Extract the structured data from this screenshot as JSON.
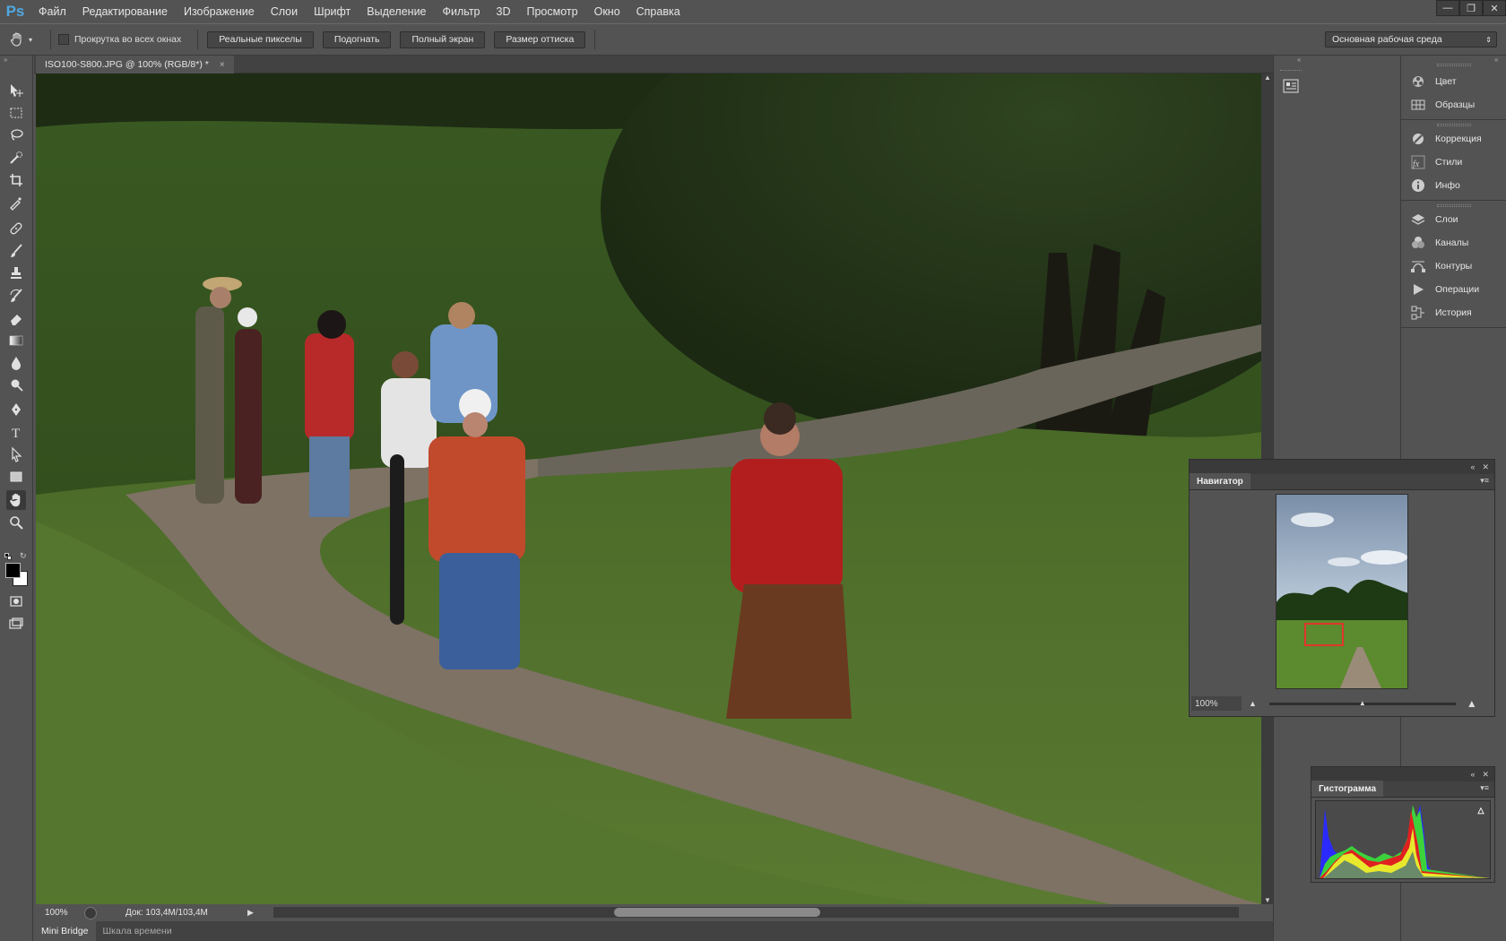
{
  "app": {
    "logo": "Ps"
  },
  "menu": [
    "Файл",
    "Редактирование",
    "Изображение",
    "Слои",
    "Шрифт",
    "Выделение",
    "Фильтр",
    "3D",
    "Просмотр",
    "Окно",
    "Справка"
  ],
  "window_controls": [
    "minimize-icon",
    "restore-icon",
    "close-icon"
  ],
  "options": {
    "scroll_all_label": "Прокрутка во всех окнах",
    "buttons": [
      "Реальные пикселы",
      "Подогнать",
      "Полный экран",
      "Размер оттиска"
    ],
    "workspace": "Основная рабочая среда"
  },
  "tools": [
    "move-icon",
    "rect-marquee-icon",
    "lasso-icon",
    "quick-select-icon",
    "crop-icon",
    "eyedropper-icon",
    "healing-brush-icon",
    "brush-icon",
    "clone-stamp-icon",
    "history-brush-icon",
    "eraser-icon",
    "gradient-icon",
    "blur-icon",
    "dodge-icon",
    "pen-icon",
    "type-icon",
    "path-select-icon",
    "rectangle-shape-icon",
    "hand-icon",
    "zoom-icon"
  ],
  "document": {
    "tab_title": "ISO100-S800.JPG @ 100% (RGB/8*) *"
  },
  "status": {
    "zoom": "100%",
    "doc": "Док: 103,4M/103,4M"
  },
  "bottom_tabs": [
    "Mini Bridge",
    "Шкала времени"
  ],
  "panels": {
    "group1": [
      {
        "label": "Цвет",
        "icon": "color-icon"
      },
      {
        "label": "Образцы",
        "icon": "swatches-icon"
      }
    ],
    "group2": [
      {
        "label": "Коррекция",
        "icon": "adjustments-icon"
      },
      {
        "label": "Стили",
        "icon": "styles-icon"
      },
      {
        "label": "Инфо",
        "icon": "info-icon"
      }
    ],
    "group3": [
      {
        "label": "Слои",
        "icon": "layers-icon"
      },
      {
        "label": "Каналы",
        "icon": "channels-icon"
      },
      {
        "label": "Контуры",
        "icon": "paths-icon"
      },
      {
        "label": "Операции",
        "icon": "actions-icon"
      },
      {
        "label": "История",
        "icon": "history-icon"
      }
    ]
  },
  "navigator": {
    "title": "Навигатор",
    "zoom": "100%"
  },
  "histogram": {
    "title": "Гистограмма",
    "warning": "!"
  },
  "colors": {
    "bg": "#535353",
    "accent": "#4fa8e0",
    "nav_box": "#e0362b"
  }
}
